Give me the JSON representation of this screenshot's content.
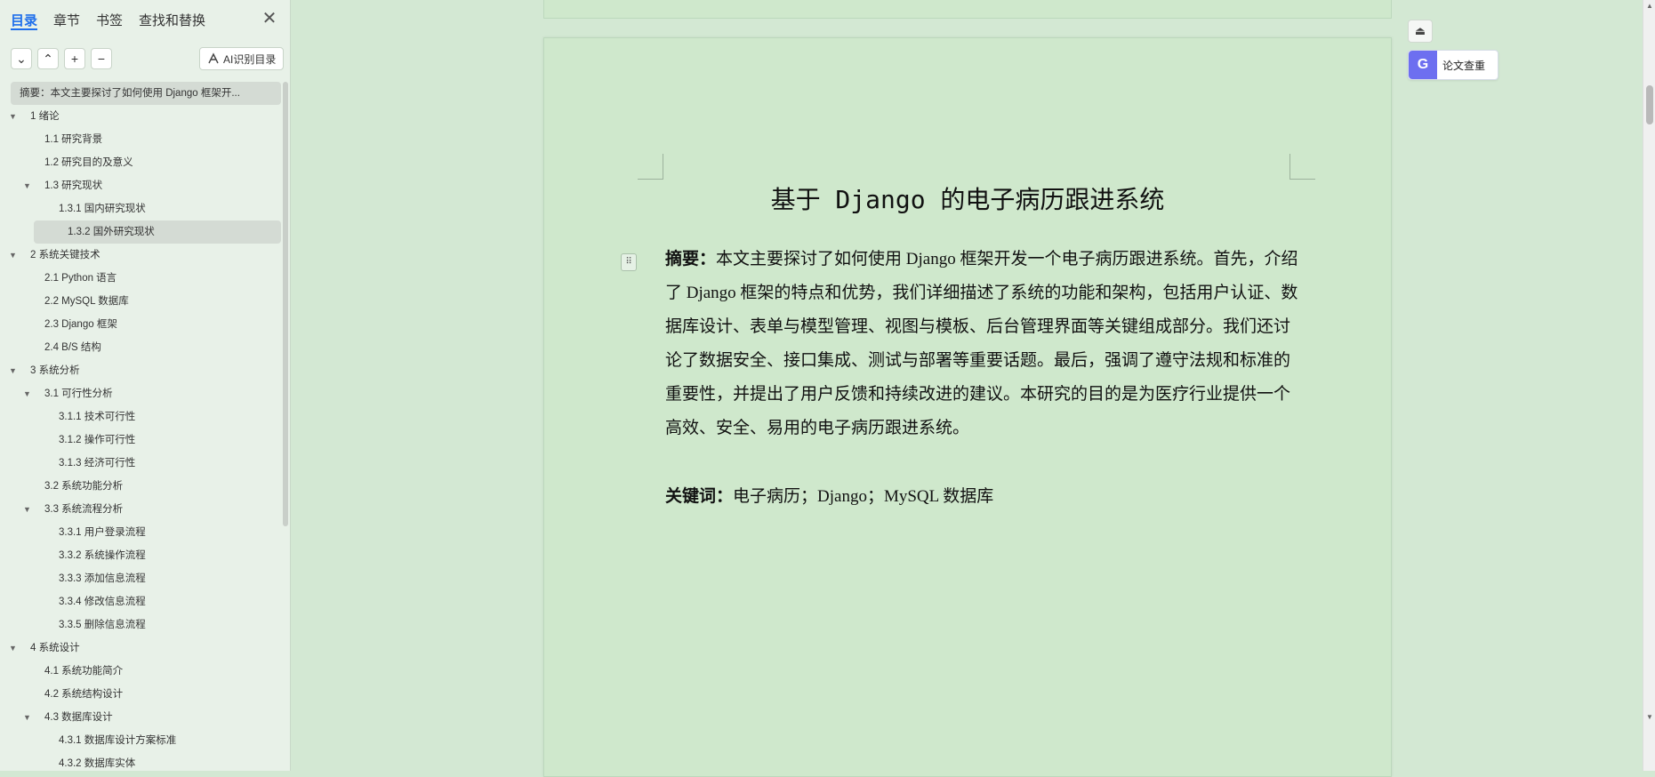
{
  "sidebar": {
    "tabs": [
      {
        "label": "目录",
        "active": true
      },
      {
        "label": "章节",
        "active": false
      },
      {
        "label": "书签",
        "active": false
      },
      {
        "label": "查找和替换",
        "active": false
      }
    ],
    "close_glyph": "✕",
    "tool_buttons": [
      "⌄",
      "⌃",
      "+",
      "−"
    ],
    "ai_button_label": "AI识别目录",
    "toc": [
      {
        "level": 0,
        "text": "摘要：本文主要探讨了如何使用 Django 框架开...",
        "arrow": "",
        "selected": true
      },
      {
        "level": 1,
        "text": "1  绪论",
        "arrow": "▼",
        "selected": false
      },
      {
        "level": 2,
        "text": "1.1  研究背景",
        "arrow": "",
        "selected": false
      },
      {
        "level": 2,
        "text": "1.2  研究目的及意义",
        "arrow": "",
        "selected": false
      },
      {
        "level": 2,
        "text": "1.3  研究现状",
        "arrow": "▼",
        "selected": false
      },
      {
        "level": 3,
        "text": "1.3.1  国内研究现状",
        "arrow": "",
        "selected": false
      },
      {
        "level": 3,
        "text": "1.3.2  国外研究现状",
        "arrow": "",
        "selected": true
      },
      {
        "level": 1,
        "text": "2  系统关键技术",
        "arrow": "▼",
        "selected": false
      },
      {
        "level": 2,
        "text": "2.1 Python 语言",
        "arrow": "",
        "selected": false
      },
      {
        "level": 2,
        "text": "2.2 MySQL 数据库",
        "arrow": "",
        "selected": false
      },
      {
        "level": 2,
        "text": "2.3 Django 框架",
        "arrow": "",
        "selected": false
      },
      {
        "level": 2,
        "text": "2.4 B/S 结构",
        "arrow": "",
        "selected": false
      },
      {
        "level": 1,
        "text": "3  系统分析",
        "arrow": "▼",
        "selected": false
      },
      {
        "level": 2,
        "text": "3.1  可行性分析",
        "arrow": "▼",
        "selected": false
      },
      {
        "level": 3,
        "text": "3.1.1  技术可行性",
        "arrow": "",
        "selected": false
      },
      {
        "level": 3,
        "text": "3.1.2  操作可行性",
        "arrow": "",
        "selected": false
      },
      {
        "level": 3,
        "text": "3.1.3  经济可行性",
        "arrow": "",
        "selected": false
      },
      {
        "level": 2,
        "text": "3.2  系统功能分析",
        "arrow": "",
        "selected": false
      },
      {
        "level": 2,
        "text": "3.3  系统流程分析",
        "arrow": "▼",
        "selected": false
      },
      {
        "level": 3,
        "text": "3.3.1  用户登录流程",
        "arrow": "",
        "selected": false
      },
      {
        "level": 3,
        "text": "3.3.2  系统操作流程",
        "arrow": "",
        "selected": false
      },
      {
        "level": 3,
        "text": "3.3.3  添加信息流程",
        "arrow": "",
        "selected": false
      },
      {
        "level": 3,
        "text": "3.3.4  修改信息流程",
        "arrow": "",
        "selected": false
      },
      {
        "level": 3,
        "text": "3.3.5  删除信息流程",
        "arrow": "",
        "selected": false
      },
      {
        "level": 1,
        "text": "4  系统设计",
        "arrow": "▼",
        "selected": false
      },
      {
        "level": 2,
        "text": "4.1  系统功能简介",
        "arrow": "",
        "selected": false
      },
      {
        "level": 2,
        "text": "4.2  系统结构设计",
        "arrow": "",
        "selected": false
      },
      {
        "level": 2,
        "text": "4.3  数据库设计",
        "arrow": "▼",
        "selected": false
      },
      {
        "level": 3,
        "text": "4.3.1  数据库设计方案标准",
        "arrow": "",
        "selected": false
      },
      {
        "level": 3,
        "text": "4.3.2  数据库实体",
        "arrow": "",
        "selected": false
      }
    ]
  },
  "document": {
    "title": "基于 Django 的电子病历跟进系统",
    "abstract_label": "摘要：",
    "abstract_text": "本文主要探讨了如何使用 Django 框架开发一个电子病历跟进系统。首先，介绍了 Django 框架的特点和优势，我们详细描述了系统的功能和架构，包括用户认证、数据库设计、表单与模型管理、视图与模板、后台管理界面等关键组成部分。我们还讨论了数据安全、接口集成、测试与部署等重要话题。最后，强调了遵守法规和标准的重要性，并提出了用户反馈和持续改进的建议。本研究的目的是为医疗行业提供一个高效、安全、易用的电子病历跟进系统。",
    "keywords_label": "关键词：",
    "keywords_text": "电子病历；Django；MySQL 数据库",
    "drag_handle_glyph": "⠿"
  },
  "right_tools": {
    "collapse_glyph": "⏏",
    "check_icon_glyph": "G",
    "check_label": "论文查重"
  },
  "scrollbar": {
    "up": "▲",
    "down": "▼"
  },
  "colors": {
    "accent": "#1f6feb",
    "page_bg": "#cfe8cc",
    "sidebar_bg": "#e8f1e8",
    "check_icon_bg": "#6d6ff0"
  }
}
